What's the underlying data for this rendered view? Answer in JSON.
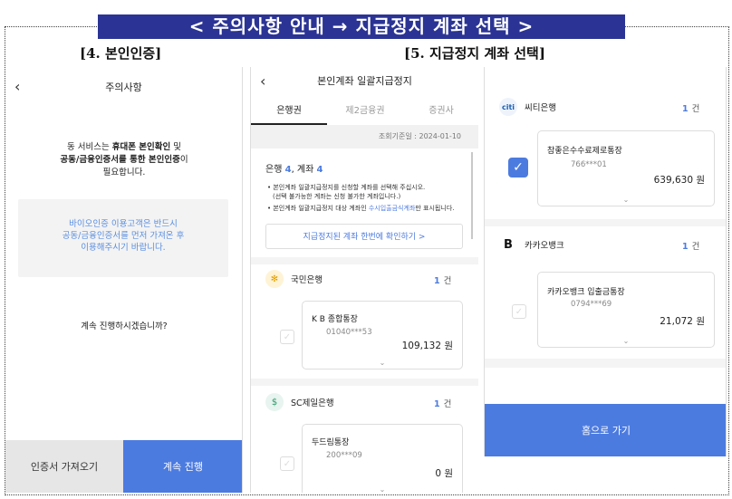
{
  "banner": "< 주의사항 안내 → 지급정지 계좌 선택 >",
  "labels": {
    "step4": "[4. 본인인증]",
    "step5": "[5. 지급정지 계좌 선택]"
  },
  "panel1": {
    "title": "주의사항",
    "notice_line1_a": "동 서비스는 ",
    "notice_line1_b": "휴대폰 본인확인",
    "notice_line1_c": " 및",
    "notice_line2_a": "공동/금융인증서를 통한 본인인증",
    "notice_line2_b": "이",
    "notice_line3": "필요합니다.",
    "bio_line1": "바이오인증 이용고객은 반드시",
    "bio_line2": "공동/금융인증서를 먼저 가져온 후",
    "bio_line3": "이용해주시기 바랍니다.",
    "ask": "계속 진행하시겠습니까?",
    "btn_import": "인증서 가져오기",
    "btn_continue": "계속 진행"
  },
  "panel2": {
    "title": "본인계좌 일괄지급정지",
    "tabs": [
      "은행권",
      "제2금융권",
      "증권사"
    ],
    "date": "조회기준일 : 2024-01-10",
    "count_prefix": "은행 ",
    "count_banks": "4",
    "count_mid": ", 계좌 ",
    "count_accounts": "4",
    "note1_line1": "• 본인계좌 일괄지급정지를 신청할 계좌를 선택해 주십시오.",
    "note1_line2": "(선택 불가능한 계좌는 신청 불가한 계좌입니다.)",
    "note2_a": "• 본인계좌 일괄지급정지 대상 계좌인 ",
    "note2_hl": "수시입출금식계좌",
    "note2_b": "만 표시됩니다.",
    "check_btn": "지급정지된 계좌 한번에 확인하기 >",
    "banks": [
      {
        "name": "국민은행",
        "count": "1",
        "unit": "건",
        "account_name": "K B 종합통장",
        "account_no": "01040***53",
        "balance": "109,132 원"
      },
      {
        "name": "SC제일은행",
        "count": "1",
        "unit": "건",
        "account_name": "두드림통장",
        "account_no": "200***09",
        "balance": "0 원"
      }
    ]
  },
  "panel3": {
    "banks": [
      {
        "logo": "citi",
        "name": "씨티은행",
        "count": "1",
        "unit": "건",
        "account_name": "참좋은수수료제로통장",
        "account_no": "766***01",
        "balance": "639,630 원"
      },
      {
        "logo": "B",
        "name": "카카오뱅크",
        "count": "1",
        "unit": "건",
        "account_name": "카카오뱅크  입출금통장",
        "account_no": "0794***69",
        "balance": "21,072 원"
      }
    ],
    "home_btn": "홈으로 가기"
  },
  "icons": {
    "back": "chevron-left-icon",
    "check": "checkmark-icon",
    "expand": "chevron-down-icon"
  },
  "colors": {
    "banner_bg": "#2b3494",
    "accent": "#4c7be0"
  }
}
